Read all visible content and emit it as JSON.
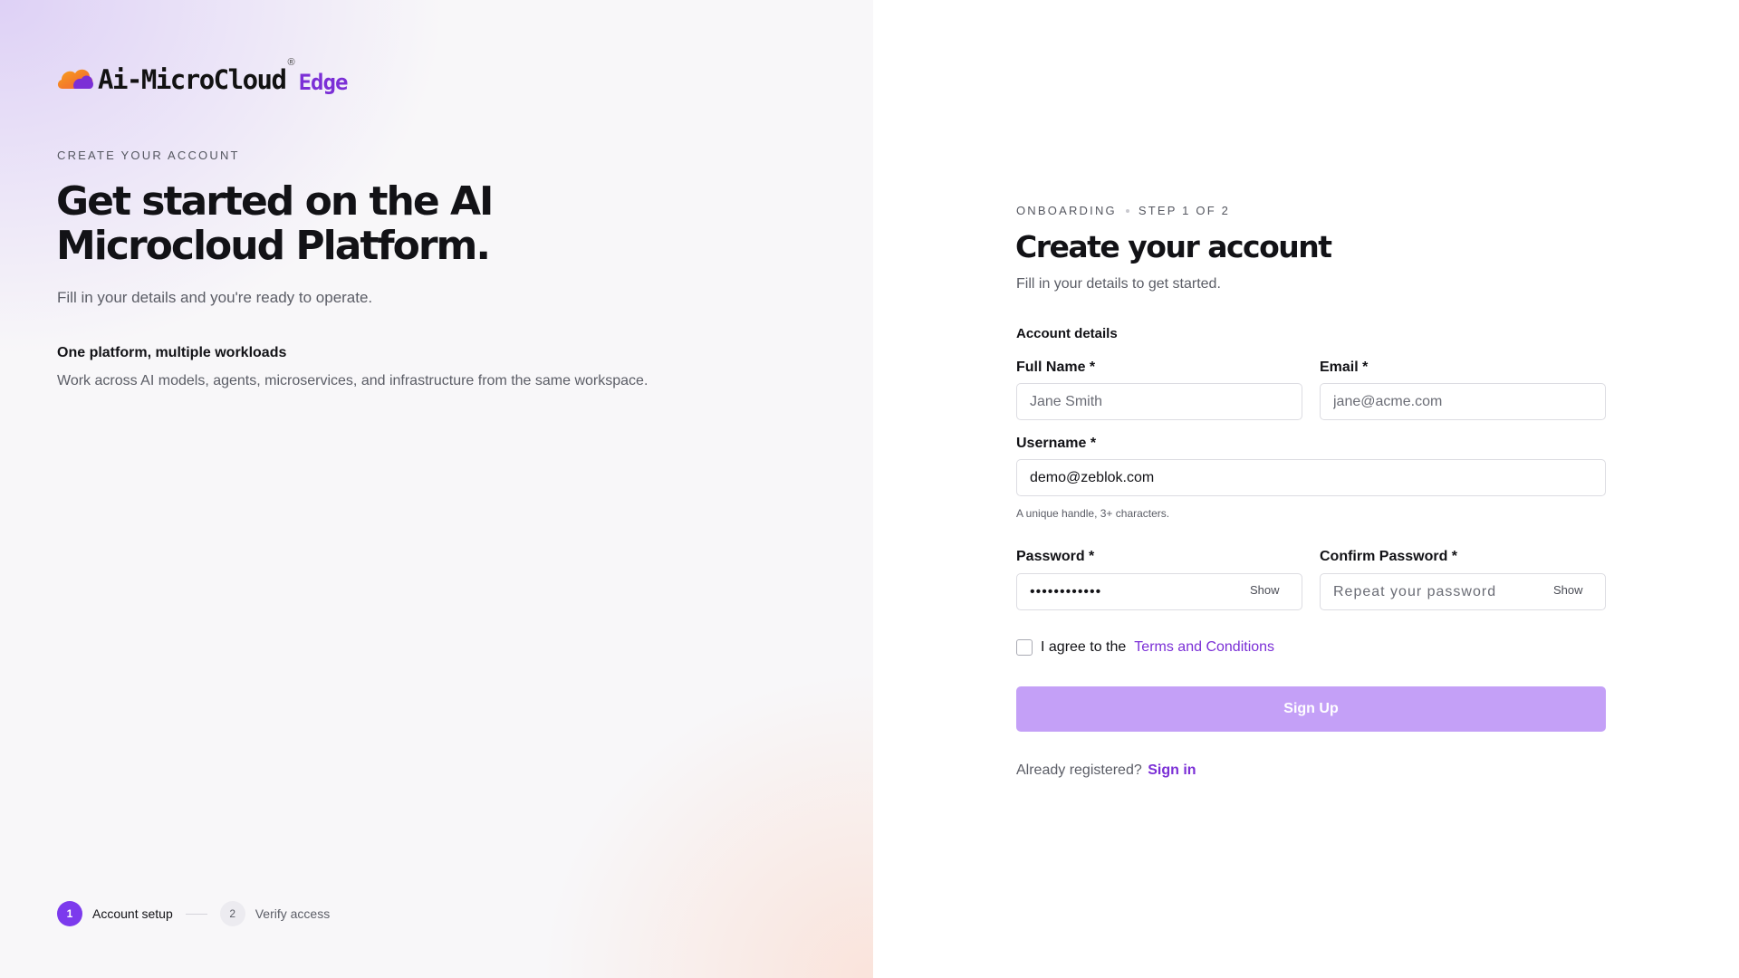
{
  "brand": {
    "name": "Ai-MicroCloud",
    "registered": "®",
    "edition": "Edge",
    "colors": {
      "accent": "#7c3aed",
      "logo_orange": "#f7931e",
      "logo_purple": "#7b2fd6"
    }
  },
  "intro": {
    "eyebrow": "CREATE YOUR ACCOUNT",
    "title_line1": "Get started on the AI",
    "title_line2": "Microcloud Platform.",
    "subtitle": "Fill in your details and you're ready to operate.",
    "feature_title": "One platform, multiple workloads",
    "feature_desc": "Work across AI models, agents, microservices, and infrastructure from the same workspace."
  },
  "stepper": {
    "steps": [
      {
        "number": "1",
        "label": "Account setup",
        "active": true
      },
      {
        "number": "2",
        "label": "Verify access",
        "active": false
      }
    ]
  },
  "form": {
    "eyebrow_left": "ONBOARDING",
    "eyebrow_right": "STEP 1 OF 2",
    "title": "Create your account",
    "subtitle": "Fill in your details to get started.",
    "section_title": "Account details",
    "full_name": {
      "label": "Full Name *",
      "placeholder": "Jane Smith",
      "value": ""
    },
    "email": {
      "label": "Email *",
      "placeholder": "jane@acme.com",
      "value": ""
    },
    "username": {
      "label": "Username *",
      "value": "demo@zeblok.com",
      "hint": "A unique handle, 3+ characters."
    },
    "password": {
      "label": "Password *",
      "value": "••••••••••••",
      "show_label": "Show"
    },
    "confirm_password": {
      "label": "Confirm Password *",
      "placeholder": "Repeat your password",
      "value": "",
      "show_label": "Show"
    },
    "agree_text": "I agree to the",
    "terms_link": "Terms and Conditions",
    "terms_checked": false,
    "submit_label": "Sign Up",
    "signin_prompt": "Already registered?",
    "signin_link": "Sign in"
  }
}
